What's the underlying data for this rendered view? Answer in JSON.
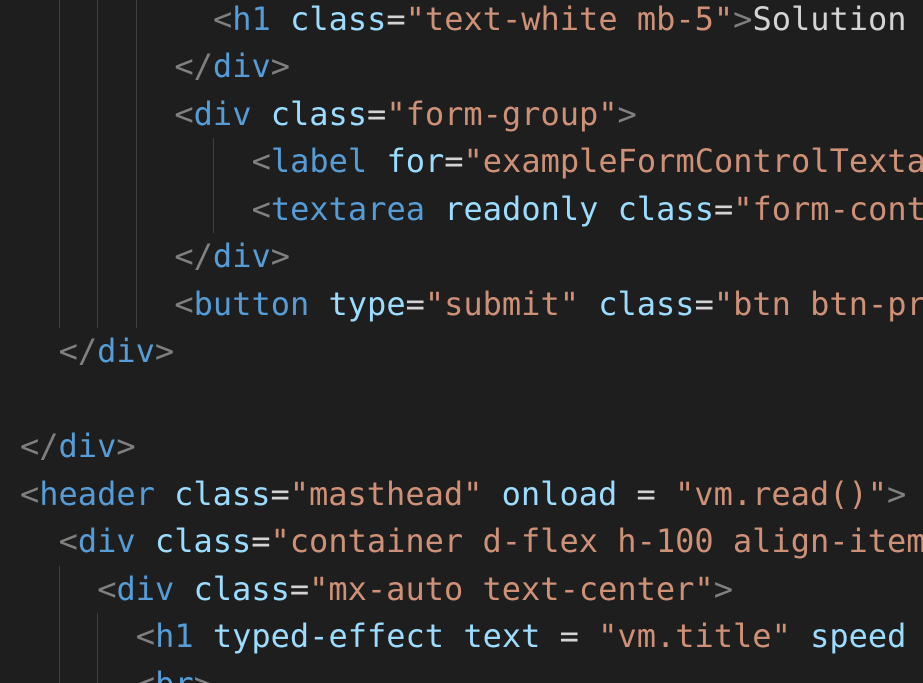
{
  "editor": {
    "language": "html",
    "theme_colors": {
      "background": "#1e1e1e",
      "bracket": "#808080",
      "tag": "#569cd6",
      "attribute": "#9cdcfe",
      "string": "#ce9178",
      "text": "#d4d4d4",
      "indent_guide": "#404040"
    },
    "lines": [
      {
        "indent": 5,
        "tokens": [
          [
            "bracket",
            "<"
          ],
          [
            "tag",
            "h1"
          ],
          [
            "text",
            " "
          ],
          [
            "attr",
            "class"
          ],
          [
            "eq",
            "="
          ],
          [
            "str",
            "\"text-white mb-5\""
          ],
          [
            "bracket",
            ">"
          ],
          [
            "text",
            "Solution"
          ]
        ]
      },
      {
        "indent": 4,
        "tokens": [
          [
            "bracket",
            "</"
          ],
          [
            "tag",
            "div"
          ],
          [
            "bracket",
            ">"
          ]
        ]
      },
      {
        "indent": 4,
        "tokens": [
          [
            "bracket",
            "<"
          ],
          [
            "tag",
            "div"
          ],
          [
            "text",
            " "
          ],
          [
            "attr",
            "class"
          ],
          [
            "eq",
            "="
          ],
          [
            "str",
            "\"form-group\""
          ],
          [
            "bracket",
            ">"
          ]
        ]
      },
      {
        "indent": 6,
        "tokens": [
          [
            "bracket",
            "<"
          ],
          [
            "tag",
            "label"
          ],
          [
            "text",
            " "
          ],
          [
            "attr",
            "for"
          ],
          [
            "eq",
            "="
          ],
          [
            "str",
            "\"exampleFormControlTexta"
          ]
        ]
      },
      {
        "indent": 6,
        "tokens": [
          [
            "bracket",
            "<"
          ],
          [
            "tag",
            "textarea"
          ],
          [
            "text",
            " "
          ],
          [
            "attr",
            "readonly"
          ],
          [
            "text",
            " "
          ],
          [
            "attr",
            "class"
          ],
          [
            "eq",
            "="
          ],
          [
            "str",
            "\"form-cont"
          ]
        ]
      },
      {
        "indent": 4,
        "tokens": [
          [
            "bracket",
            "</"
          ],
          [
            "tag",
            "div"
          ],
          [
            "bracket",
            ">"
          ]
        ]
      },
      {
        "indent": 4,
        "tokens": [
          [
            "bracket",
            "<"
          ],
          [
            "tag",
            "button"
          ],
          [
            "text",
            " "
          ],
          [
            "attr",
            "type"
          ],
          [
            "eq",
            "="
          ],
          [
            "str",
            "\"submit\""
          ],
          [
            "text",
            " "
          ],
          [
            "attr",
            "class"
          ],
          [
            "eq",
            "="
          ],
          [
            "str",
            "\"btn btn-pr"
          ]
        ]
      },
      {
        "indent": 1,
        "tokens": [
          [
            "bracket",
            "</"
          ],
          [
            "tag",
            "div"
          ],
          [
            "bracket",
            ">"
          ]
        ]
      },
      {
        "indent": 0,
        "tokens": []
      },
      {
        "indent": 0,
        "tokens": [
          [
            "bracket",
            "</"
          ],
          [
            "tag",
            "div"
          ],
          [
            "bracket",
            ">"
          ]
        ]
      },
      {
        "indent": 0,
        "tokens": [
          [
            "bracket",
            "<"
          ],
          [
            "tag",
            "header"
          ],
          [
            "text",
            " "
          ],
          [
            "attr",
            "class"
          ],
          [
            "eq",
            "="
          ],
          [
            "str",
            "\"masthead\""
          ],
          [
            "text",
            " "
          ],
          [
            "attr",
            "onload"
          ],
          [
            "text",
            " "
          ],
          [
            "eq",
            "="
          ],
          [
            "text",
            " "
          ],
          [
            "str",
            "\"vm.read()\""
          ],
          [
            "bracket",
            ">"
          ]
        ]
      },
      {
        "indent": 1,
        "tokens": [
          [
            "bracket",
            "<"
          ],
          [
            "tag",
            "div"
          ],
          [
            "text",
            " "
          ],
          [
            "attr",
            "class"
          ],
          [
            "eq",
            "="
          ],
          [
            "str",
            "\"container d-flex h-100 align-item"
          ]
        ]
      },
      {
        "indent": 2,
        "tokens": [
          [
            "bracket",
            "<"
          ],
          [
            "tag",
            "div"
          ],
          [
            "text",
            " "
          ],
          [
            "attr",
            "class"
          ],
          [
            "eq",
            "="
          ],
          [
            "str",
            "\"mx-auto text-center\""
          ],
          [
            "bracket",
            ">"
          ]
        ]
      },
      {
        "indent": 3,
        "tokens": [
          [
            "bracket",
            "<"
          ],
          [
            "tag",
            "h1"
          ],
          [
            "text",
            " "
          ],
          [
            "attr",
            "typed-effect"
          ],
          [
            "text",
            " "
          ],
          [
            "attr",
            "text"
          ],
          [
            "text",
            " "
          ],
          [
            "eq",
            "="
          ],
          [
            "text",
            " "
          ],
          [
            "str",
            "\"vm.title\""
          ],
          [
            "text",
            " "
          ],
          [
            "attr",
            "speed"
          ]
        ]
      },
      {
        "indent": 3,
        "tokens": [
          [
            "bracket",
            "<"
          ],
          [
            "tag",
            "br"
          ],
          [
            "bracket",
            ">"
          ]
        ]
      }
    ]
  }
}
